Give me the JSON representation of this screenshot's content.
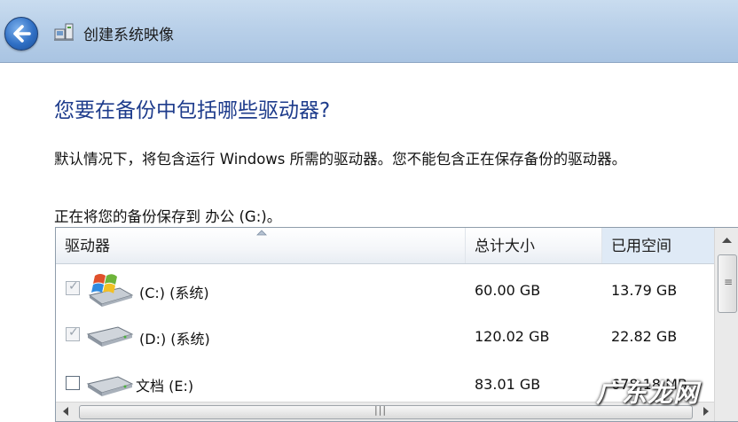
{
  "window": {
    "title": "创建系统映像",
    "back_icon": "back-arrow-icon",
    "app_icon": "backup-icon"
  },
  "page": {
    "heading": "您要在备份中包括哪些驱动器?",
    "description": "默认情况下，将包含运行 Windows 所需的驱动器。您不能包含正在保存备份的驱动器。",
    "save_location": "正在将您的备份保存到 办公 (G:)。"
  },
  "table": {
    "columns": [
      "驱动器",
      "总计大小",
      "已用空间"
    ],
    "sorted_column": "驱动器",
    "rows": [
      {
        "name": "(C:) (系统)",
        "total": "60.00 GB",
        "used": "13.79 GB",
        "checked": true,
        "disabled": true,
        "icon": "windows-drive-icon"
      },
      {
        "name": "(D:) (系统)",
        "total": "120.02 GB",
        "used": "22.82 GB",
        "checked": true,
        "disabled": true,
        "icon": "drive-icon"
      },
      {
        "name": "文档 (E:)",
        "total": "83.01 GB",
        "used": "678.18 MB",
        "checked": false,
        "disabled": false,
        "icon": "drive-icon"
      }
    ]
  },
  "watermark": "广东龙网",
  "colors": {
    "heading": "#1e3c8c",
    "titlebar": "#b9d0e9",
    "selected_header": "#dfeaf6"
  }
}
